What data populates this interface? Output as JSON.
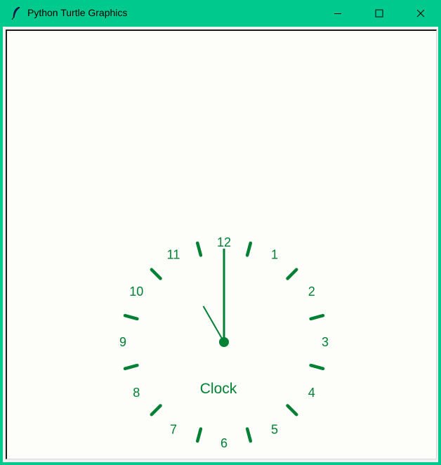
{
  "window": {
    "title": "Python Turtle Graphics",
    "icon": "feather-icon",
    "controls": [
      "minimize-icon",
      "maximize-icon",
      "close-icon"
    ]
  },
  "canvas": {
    "background": "#fdfdf9",
    "ink_color": "#008033",
    "clock": {
      "label": "Clock",
      "numerals": [
        "12",
        "1",
        "2",
        "3",
        "4",
        "5",
        "6",
        "7",
        "8",
        "9",
        "10",
        "11"
      ],
      "hour_marks": 12,
      "time_shown": {
        "hour": 11,
        "minute": 0
      }
    }
  },
  "colors": {
    "titlebar": "#00c98d",
    "title_text": "#000000",
    "clock_green": "#008033"
  }
}
